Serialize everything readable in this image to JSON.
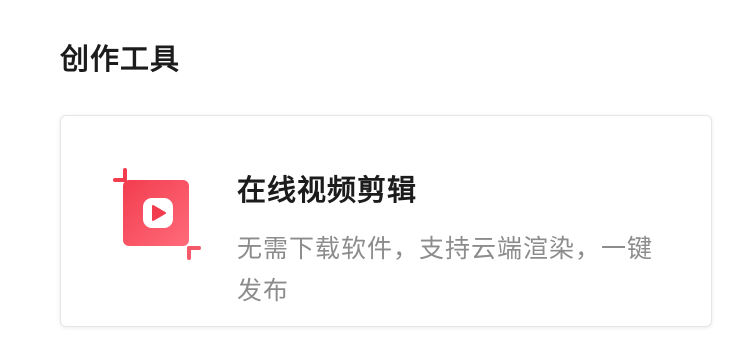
{
  "section": {
    "title": "创作工具"
  },
  "tool": {
    "title": "在线视频剪辑",
    "description": "无需下载软件，支持云端渲染，一键发布",
    "icon": "video-crop-play-icon",
    "accent_color": "#f23d4f",
    "accent_color_light": "#ff6b7a"
  }
}
